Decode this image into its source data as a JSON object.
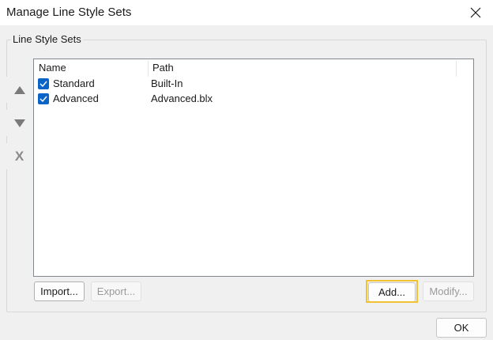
{
  "window": {
    "title": "Manage Line Style Sets"
  },
  "group": {
    "label": "Line Style Sets"
  },
  "side_buttons": [
    {
      "icon": "triangle-up-icon"
    },
    {
      "icon": "triangle-down-icon"
    },
    {
      "icon": "delete-x-icon",
      "glyph": "X"
    }
  ],
  "list": {
    "columns": [
      "Name",
      "Path"
    ],
    "rows": [
      {
        "checked": true,
        "name": "Standard",
        "path": "Built-In"
      },
      {
        "checked": true,
        "name": "Advanced",
        "path": "Advanced.blx"
      }
    ]
  },
  "buttons": {
    "import": "Import...",
    "export": "Export...",
    "add": "Add...",
    "modify": "Modify...",
    "ok": "OK"
  },
  "colors": {
    "checkbox": "#0a64c8",
    "highlight": "#f2c232"
  }
}
